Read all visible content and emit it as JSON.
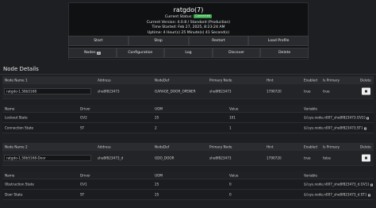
{
  "panel": {
    "title": "ratgdo(7)",
    "status_label": "Current Status:",
    "status_badge": "Connected",
    "version": "Current Version: 4.0.8 / Standard (Production)",
    "started": "Time Started: Feb 27, 2025, 8:23:24 AM",
    "uptime": "Uptime: 4 Hour(s) 25 Minute(s) 41 Second(s)"
  },
  "buttons_row1": [
    "Start",
    "Stop",
    "Restart",
    "Load Profile"
  ],
  "buttons_row2": {
    "nodes_label": "Nodes",
    "nodes_count": "2",
    "others": [
      "Configuration",
      "Log",
      "Discover",
      "Delete"
    ]
  },
  "section_title": "Node Details",
  "headers": {
    "address": "Address",
    "nodedef": "NodeDef",
    "primary_node": "Primary Node",
    "hint": "Hint",
    "enabled": "Enabled",
    "is_primary": "Is Primary",
    "delete": "Delete",
    "name": "Name",
    "driver": "Driver",
    "uom": "UOM",
    "value": "Value",
    "variable": "Variable"
  },
  "nodes": [
    {
      "name_header": "Node Name 1",
      "name": "ratgdo-1.58b5168",
      "address": "she8f823473",
      "nodedef": "GARAGE_DOOR_OPENER",
      "primary": "she8f823473",
      "hint": "1790720",
      "enabled": "true",
      "is_primary": "true",
      "drivers": [
        {
          "name": "Lockout State",
          "driver": "GV2",
          "uom": "25",
          "value": "101",
          "variable": "${sys.node.n007_she8f823473.GV2}"
        },
        {
          "name": "Connection State",
          "driver": "ST",
          "uom": "2",
          "value": "1",
          "variable": "${sys.node.n007_she8f823473.ST}"
        }
      ]
    },
    {
      "name_header": "Node Name 2",
      "name": "ratgdo-1.58b5168-Door",
      "address": "she8f823473_d",
      "nodedef": "GDO_DOOR",
      "primary": "she8f823473",
      "hint": "1790720",
      "enabled": "true",
      "is_primary": "false",
      "drivers": [
        {
          "name": "Obstruction State",
          "driver": "GV1",
          "uom": "25",
          "value": "0",
          "variable": "${sys.node.n007_she8f823473_d.GV1}"
        },
        {
          "name": "Door State",
          "driver": "ST",
          "uom": "25",
          "value": "0",
          "variable": "${sys.node.n007_she8f823473_d.ST}"
        }
      ]
    }
  ]
}
